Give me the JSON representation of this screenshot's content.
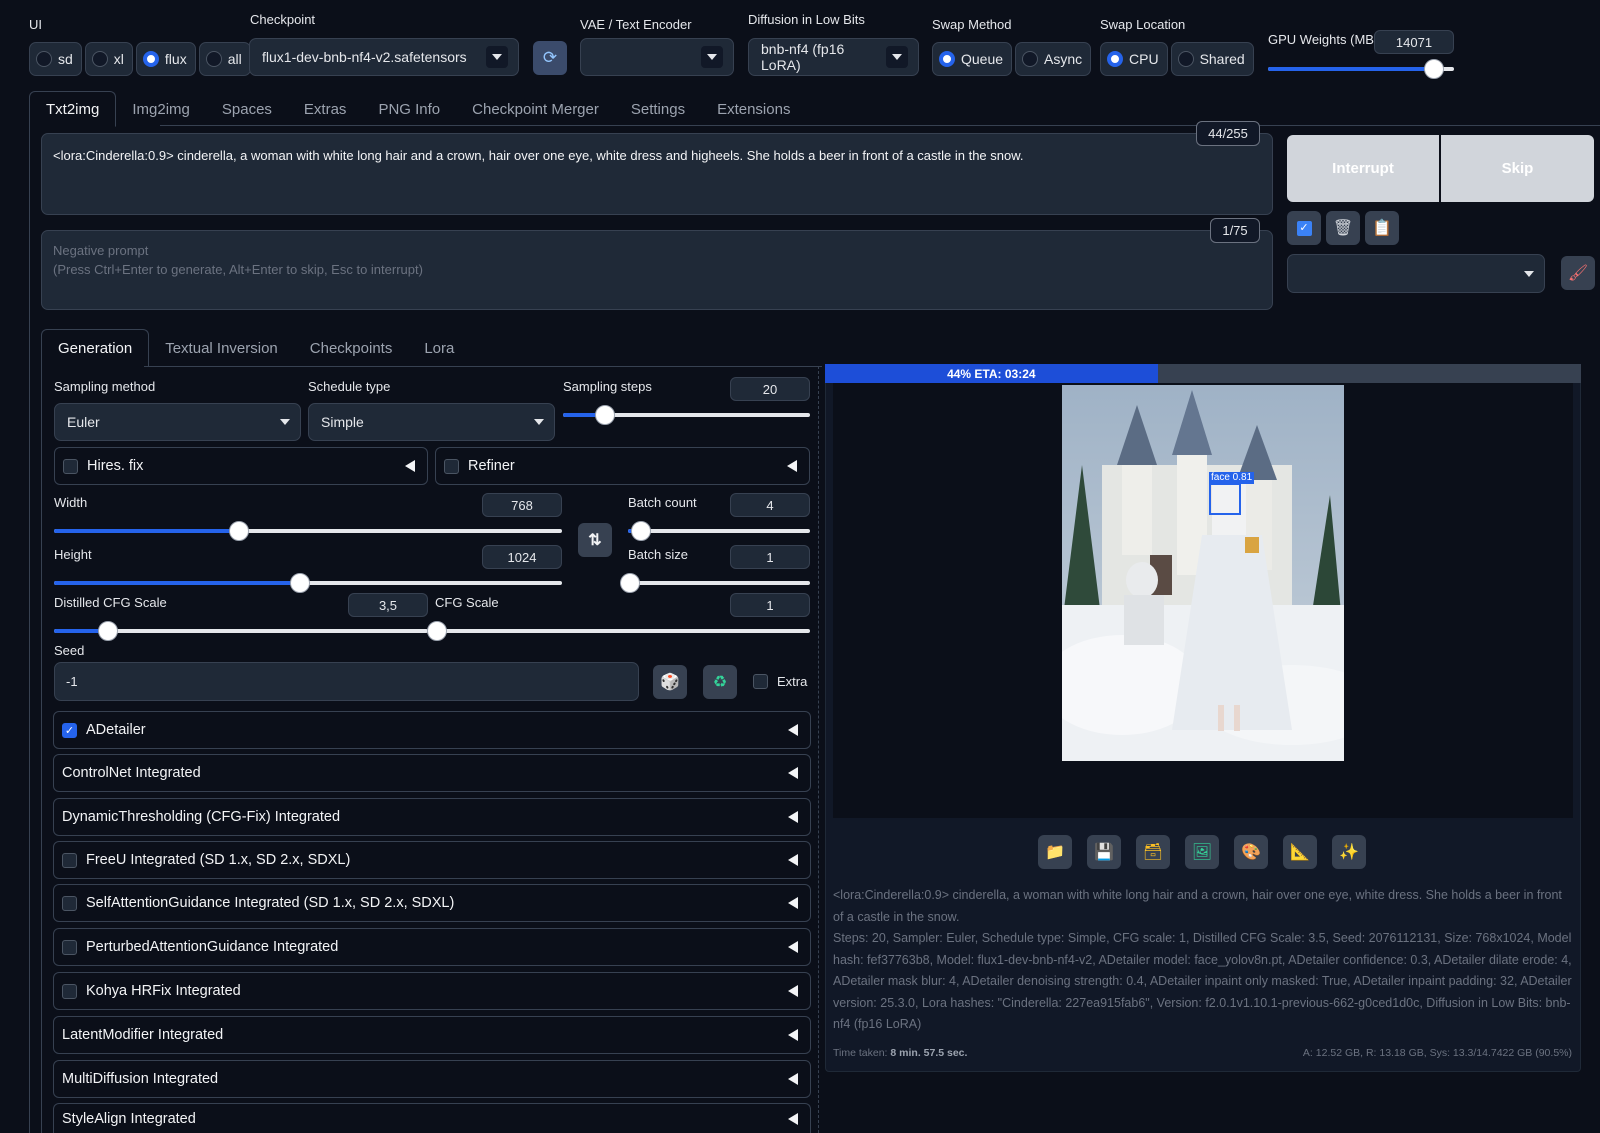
{
  "top": {
    "ui_label": "UI",
    "ui_options": [
      {
        "label": "sd",
        "selected": false
      },
      {
        "label": "xl",
        "selected": false
      },
      {
        "label": "flux",
        "selected": true
      },
      {
        "label": "all",
        "selected": false
      }
    ],
    "checkpoint_label": "Checkpoint",
    "checkpoint_value": "flux1-dev-bnb-nf4-v2.safetensors",
    "refresh_icon": "refresh-icon",
    "vae_label": "VAE / Text Encoder",
    "vae_value": "",
    "diffusion_label": "Diffusion in Low Bits",
    "diffusion_value": "bnb-nf4 (fp16 LoRA)",
    "swap_method_label": "Swap Method",
    "swap_method_options": [
      {
        "label": "Queue",
        "selected": true
      },
      {
        "label": "Async",
        "selected": false
      }
    ],
    "swap_location_label": "Swap Location",
    "swap_location_options": [
      {
        "label": "CPU",
        "selected": true
      },
      {
        "label": "Shared",
        "selected": false
      }
    ],
    "gpu_weights_label": "GPU Weights (MB)",
    "gpu_weights_value": "14071",
    "gpu_weights_fraction": 0.88
  },
  "main_tabs": [
    "Txt2img",
    "Img2img",
    "Spaces",
    "Extras",
    "PNG Info",
    "Checkpoint Merger",
    "Settings",
    "Extensions"
  ],
  "prompt": {
    "text": "<lora:Cinderella:0.9> cinderella, a woman with white long hair and a crown, hair over one eye, white dress and higheels. She holds a beer in front of a castle in the snow.",
    "token_count": "44/255",
    "negative_label": "Negative prompt",
    "negative_placeholder": "(Press Ctrl+Enter to generate, Alt+Enter to skip, Esc to interrupt)",
    "negative_token_count": "1/75"
  },
  "actions": {
    "interrupt": "Interrupt",
    "skip": "Skip",
    "tool_icons": [
      "checkbox-icon",
      "trash-icon",
      "clipboard-icon"
    ],
    "styles_value": "",
    "brush_icon": "brush-icon"
  },
  "sub_tabs": [
    "Generation",
    "Textual Inversion",
    "Checkpoints",
    "Lora"
  ],
  "generation": {
    "sampling_method_label": "Sampling method",
    "sampling_method_value": "Euler",
    "schedule_type_label": "Schedule type",
    "schedule_type_value": "Simple",
    "sampling_steps_label": "Sampling steps",
    "sampling_steps_value": "20",
    "sampling_steps_fraction": 0.16,
    "hires_label": "Hires. fix",
    "refiner_label": "Refiner",
    "width_label": "Width",
    "width_value": "768",
    "width_fraction": 0.36,
    "height_label": "Height",
    "height_value": "1024",
    "height_fraction": 0.48,
    "batch_count_label": "Batch count",
    "batch_count_value": "4",
    "batch_count_fraction": 0.06,
    "batch_size_label": "Batch size",
    "batch_size_value": "1",
    "batch_size_fraction": 0.0,
    "distilled_cfg_label": "Distilled CFG Scale",
    "distilled_cfg_value": "3,5",
    "distilled_cfg_fraction": 0.14,
    "cfg_label": "CFG Scale",
    "cfg_value": "1",
    "cfg_fraction": 0.0,
    "seed_label": "Seed",
    "seed_value": "-1",
    "extra_label": "Extra",
    "swap_icon": "swap-vertical-icon",
    "dice_icon": "dice-icon",
    "recycle_icon": "recycle-icon"
  },
  "accordions": [
    {
      "label": "ADetailer",
      "checkbox": true,
      "checked": true
    },
    {
      "label": "ControlNet Integrated",
      "checkbox": false,
      "checked": false
    },
    {
      "label": "DynamicThresholding (CFG-Fix) Integrated",
      "checkbox": false,
      "checked": false
    },
    {
      "label": "FreeU Integrated (SD 1.x, SD 2.x, SDXL)",
      "checkbox": true,
      "checked": false
    },
    {
      "label": "SelfAttentionGuidance Integrated (SD 1.x, SD 2.x, SDXL)",
      "checkbox": true,
      "checked": false
    },
    {
      "label": "PerturbedAttentionGuidance Integrated",
      "checkbox": true,
      "checked": false
    },
    {
      "label": "Kohya HRFix Integrated",
      "checkbox": true,
      "checked": false
    },
    {
      "label": "LatentModifier Integrated",
      "checkbox": false,
      "checked": false
    },
    {
      "label": "MultiDiffusion Integrated",
      "checkbox": false,
      "checked": false
    },
    {
      "label": "StyleAlign Integrated",
      "checkbox": false,
      "checked": false
    }
  ],
  "output": {
    "progress_text": "44% ETA: 03:24",
    "progress_fraction": 0.44,
    "face_label": "face 0.81",
    "toolbar_icons": [
      "folder-icon",
      "save-icon",
      "zip-icon",
      "image-icon",
      "palette-icon",
      "ruler-icon",
      "sparkle-icon"
    ],
    "info_prompt": "<lora:Cinderella:0.9> cinderella, a woman with white long hair and a crown, hair over one eye, white dress. She holds a beer in front of a castle in the snow.",
    "info_params": "Steps: 20, Sampler: Euler, Schedule type: Simple, CFG scale: 1, Distilled CFG Scale: 3.5, Seed: 2076112131, Size: 768x1024, Model hash: fef37763b8, Model: flux1-dev-bnb-nf4-v2, ADetailer model: face_yolov8n.pt, ADetailer confidence: 0.3, ADetailer dilate erode: 4, ADetailer mask blur: 4, ADetailer denoising strength: 0.4, ADetailer inpaint only masked: True, ADetailer inpaint padding: 32, ADetailer version: 25.3.0, Lora hashes: \"Cinderella: 227ea915fab6\", Version: f2.0.1v1.10.1-previous-662-g0ced1d0c, Diffusion in Low Bits: bnb-nf4 (fp16 LoRA)",
    "time_label": "Time taken:",
    "time_value": "8 min. 57.5 sec.",
    "memory": "A: 12.52 GB, R: 13.18 GB, Sys: 13.3/14.7422 GB (90.5%)"
  }
}
